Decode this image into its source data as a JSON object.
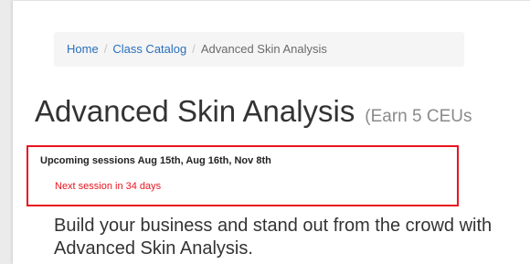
{
  "breadcrumb": {
    "items": [
      {
        "label": "Home"
      },
      {
        "label": "Class Catalog"
      },
      {
        "label": "Advanced Skin Analysis"
      }
    ],
    "separator": "/"
  },
  "course": {
    "title": "Advanced Skin Analysis",
    "ceu_note": "(Earn 5 CEUs",
    "upcoming_sessions": "Upcoming sessions Aug 15th, Aug 16th, Nov 8th",
    "next_session": "Next session in 34 days",
    "intro": "Build your business and stand out from the crowd with Advanced Skin Analysis."
  },
  "colors": {
    "link": "#2a6fbb",
    "highlight_border": "#e8141f",
    "next_session_text": "#e8141f"
  }
}
